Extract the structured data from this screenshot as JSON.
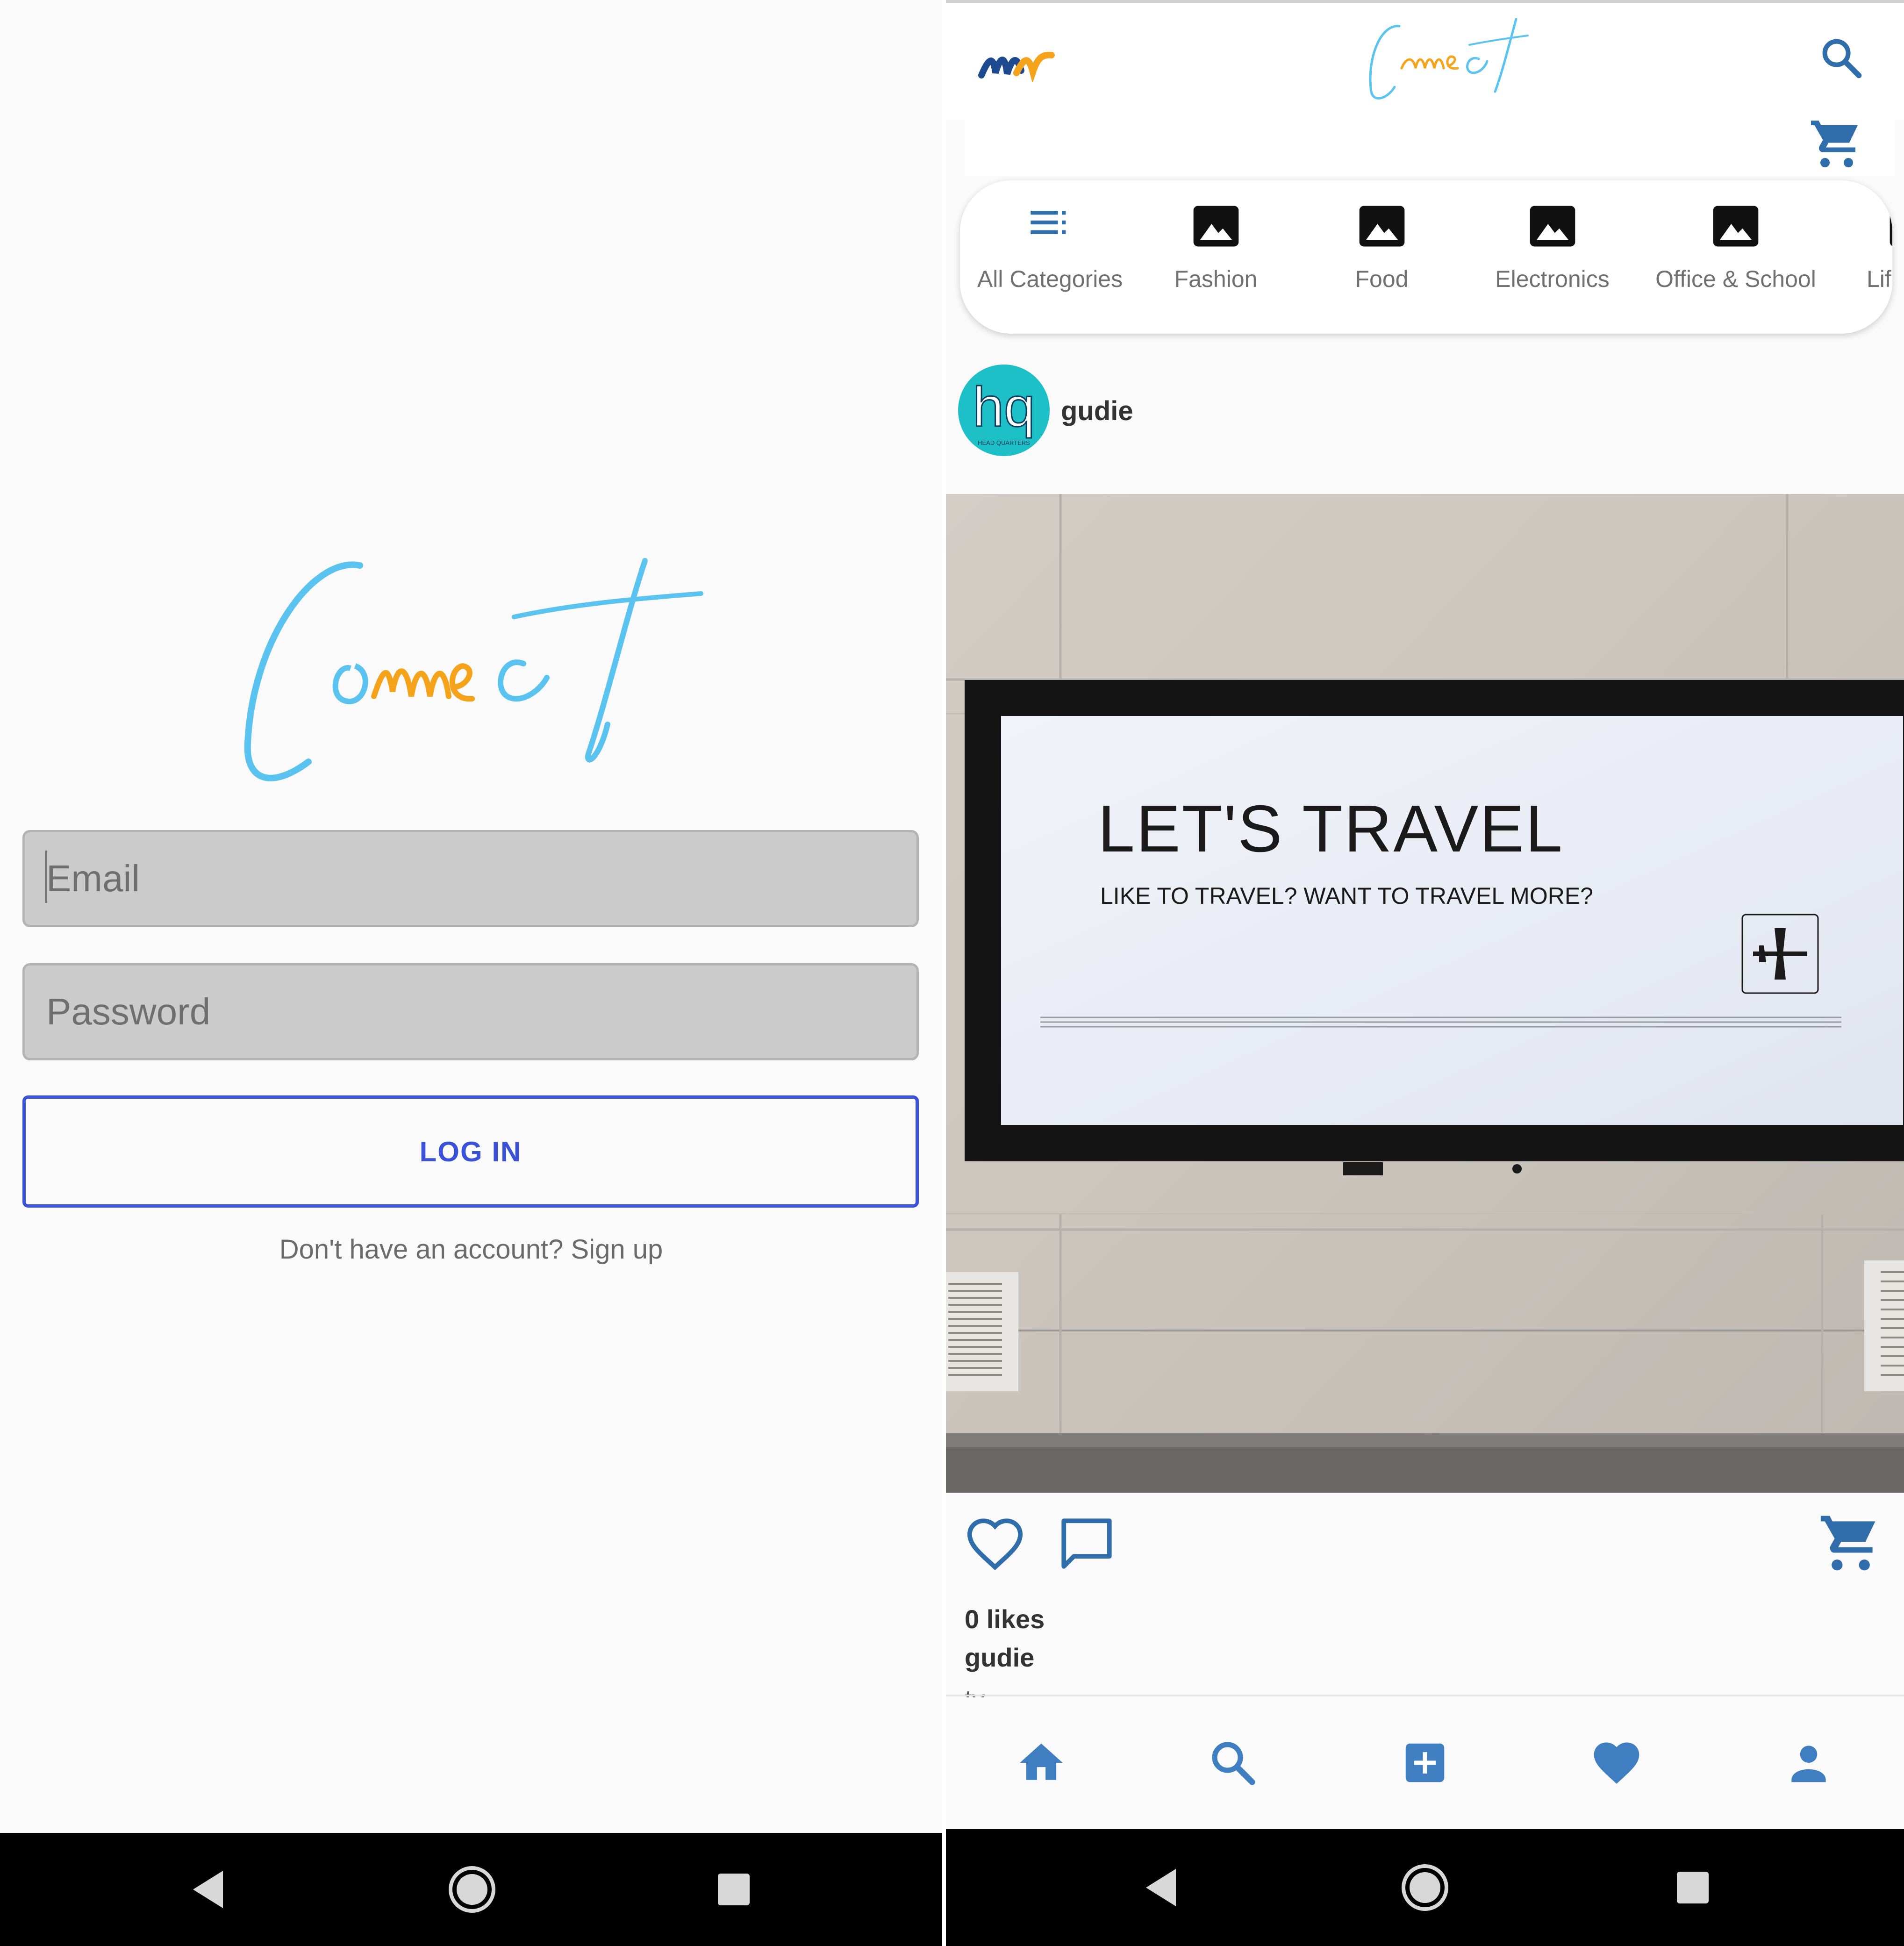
{
  "login": {
    "logo_text": "Connect",
    "email_placeholder": "Email",
    "password_placeholder": "Password",
    "login_label": "LOG IN",
    "signup_text": "Don't have an account? Sign up"
  },
  "feed": {
    "header": {
      "logo_text": "Connect",
      "brand_mark": "nw"
    },
    "categories": [
      {
        "label": "All Categories",
        "icon": "list-icon"
      },
      {
        "label": "Fashion",
        "icon": "image-icon"
      },
      {
        "label": "Food",
        "icon": "image-icon"
      },
      {
        "label": "Electronics",
        "icon": "image-icon"
      },
      {
        "label": "Office & School",
        "icon": "image-icon"
      },
      {
        "label": "Life",
        "icon": "image-icon"
      }
    ],
    "post": {
      "avatar_letters": "hq",
      "avatar_subtext": "HEAD QUARTERS",
      "username": "gudie",
      "image_headline": "LET'S TRAVEL",
      "image_subline": "LIKE TO TRAVEL? WANT TO TRAVEL MORE?",
      "likes": "0 likes",
      "caption_user": "gudie",
      "caption_text": "tv"
    }
  },
  "colors": {
    "accent_blue": "#3a52d8",
    "icon_blue": "#2f6eaa",
    "nav_blue": "#3f7fc1",
    "logo_cyan": "#5bc3f0",
    "logo_orange": "#f5a31a"
  }
}
